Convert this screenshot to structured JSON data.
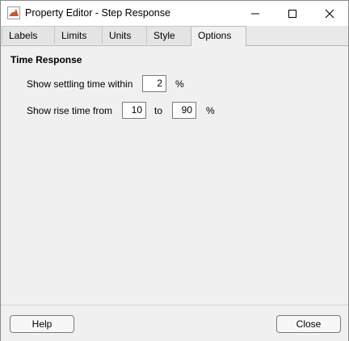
{
  "window": {
    "title": "Property Editor - Step Response",
    "controls": {
      "minimize": "minimize-icon",
      "maximize": "maximize-icon",
      "close": "close-icon"
    }
  },
  "tabs": [
    "Labels",
    "Limits",
    "Units",
    "Style",
    "Options"
  ],
  "active_tab": "Options",
  "options": {
    "section_title": "Time Response",
    "settling": {
      "label": "Show settling time within",
      "value": "2",
      "unit": "%"
    },
    "rise": {
      "label": "Show rise time from",
      "from": "10",
      "to_label": "to",
      "to": "90",
      "unit": "%"
    }
  },
  "footer": {
    "help_label": "Help",
    "close_label": "Close"
  },
  "colors": {
    "window_bg": "#f0f0f0",
    "titlebar_bg": "#ffffff",
    "border": "#8a8a8a"
  }
}
